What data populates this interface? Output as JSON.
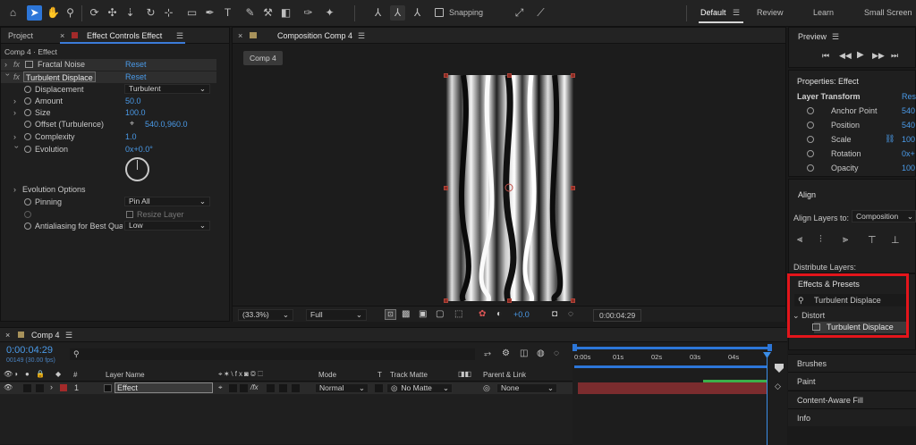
{
  "toolbar": {
    "snapping_label": "Snapping",
    "workspaces": [
      "Default",
      "Review",
      "Learn",
      "Small Screen"
    ]
  },
  "left_panel": {
    "tabs": [
      "Project",
      "Effect Controls Effect"
    ],
    "breadcrumb": "Comp 4 · Effect",
    "fractal_noise": {
      "fx": "fx",
      "name": "Fractal Noise",
      "reset": "Reset"
    },
    "turbulent": {
      "fx": "fx",
      "name": "Turbulent Displace",
      "reset": "Reset"
    },
    "properties": [
      {
        "label": "Displacement",
        "value": "Turbulent"
      },
      {
        "label": "Amount",
        "value": "50.0"
      },
      {
        "label": "Size",
        "value": "100.0"
      },
      {
        "label": "Offset (Turbulence)",
        "value": "540.0,960.0"
      },
      {
        "label": "Complexity",
        "value": "1.0"
      },
      {
        "label": "Evolution",
        "value": "0x+0.0°"
      },
      {
        "label": "Evolution Options",
        "value": ""
      },
      {
        "label": "Pinning",
        "value": "Pin All"
      },
      {
        "label": "",
        "value": "Resize Layer"
      },
      {
        "label": "Antialiasing for Best Quali",
        "value": "Low"
      }
    ]
  },
  "viewer": {
    "tab": "Composition Comp 4",
    "comp_button": "Comp 4",
    "zoom": "(33.3%)",
    "resolution": "Full",
    "exposure": "+0.0",
    "timecode": "0:00:04:29"
  },
  "right_panel": {
    "preview": "Preview",
    "properties_title": "Properties: Effect",
    "layer_transform": "Layer Transform",
    "reset": "Rese",
    "transform": [
      {
        "label": "Anchor Point",
        "value": "540"
      },
      {
        "label": "Position",
        "value": "540"
      },
      {
        "label": "Scale",
        "value": "100"
      },
      {
        "label": "Rotation",
        "value": "0x+"
      },
      {
        "label": "Opacity",
        "value": "100"
      }
    ],
    "align": "Align",
    "align_layers_to": "Align Layers to:",
    "align_target": "Composition",
    "distribute_layers": "Distribute Layers:",
    "effects_presets": "Effects & Presets",
    "search_value": "Turbulent Displace",
    "category": "Distort",
    "result": "Turbulent Displace",
    "panels": [
      "Brushes",
      "Paint",
      "Content-Aware Fill",
      "Info"
    ]
  },
  "timeline": {
    "tab": "Comp 4",
    "timecode": "0:00:04:29",
    "frames": "00149 (30.00 fps)",
    "columns": [
      "#",
      "Layer Name",
      "Mode",
      "T",
      "Track Matte",
      "Parent & Link"
    ],
    "ruler": [
      "0:00s",
      "01s",
      "02s",
      "03s",
      "04s"
    ],
    "layer": {
      "index": "1",
      "name": "Effect",
      "mode": "Normal",
      "matte": "No Matte",
      "parent": "None"
    }
  }
}
